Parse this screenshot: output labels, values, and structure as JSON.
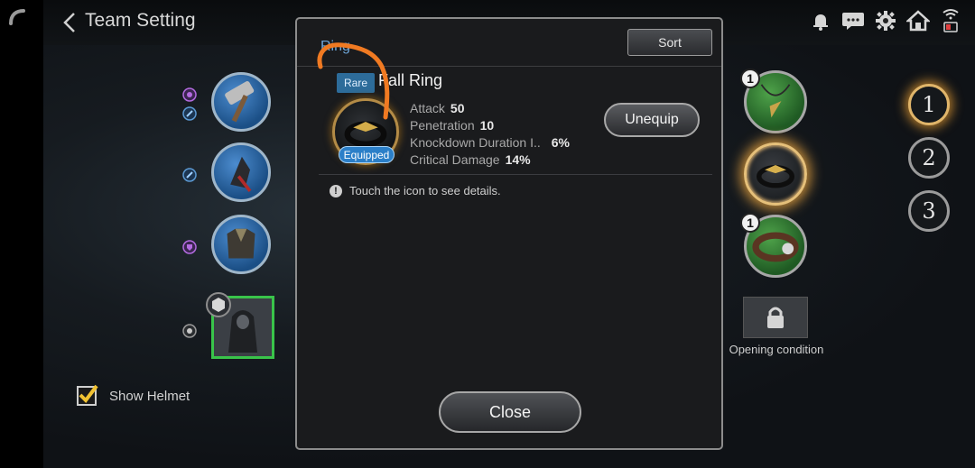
{
  "header": {
    "title": "Team Setting"
  },
  "top_icons": [
    "bell-icon",
    "chat-icon",
    "gear-icon",
    "home-icon",
    "wifi-battery-icon"
  ],
  "left_panel": {
    "show_helmet": {
      "label": "Show Helmet",
      "checked": true
    }
  },
  "right_panel": {
    "slots": [
      {
        "name": "necklace",
        "count": "1"
      },
      {
        "name": "ring",
        "selected": true
      },
      {
        "name": "belt",
        "count": "1"
      }
    ],
    "locked_slot": {
      "label": "Opening condition"
    },
    "presets": [
      "1",
      "2",
      "3"
    ],
    "active_preset": "1"
  },
  "modal": {
    "category": "Ring",
    "sort_label": "Sort",
    "item": {
      "rarity": "Rare",
      "name": "Fall Ring",
      "status": "Equipped",
      "stats": [
        {
          "label": "Attack",
          "value": "50"
        },
        {
          "label": "Penetration",
          "value": "10"
        },
        {
          "label": "Knockdown Duration I..",
          "value": "6%"
        },
        {
          "label": "Critical Damage",
          "value": "14%"
        }
      ]
    },
    "unequip_label": "Unequip",
    "hint": "Touch the icon to see details.",
    "close_label": "Close"
  },
  "colors": {
    "accent_blue": "#2b7fc8",
    "slot_green": "#39c44a",
    "glow_gold": "#c98f3a",
    "scribble": "#f07a22"
  }
}
